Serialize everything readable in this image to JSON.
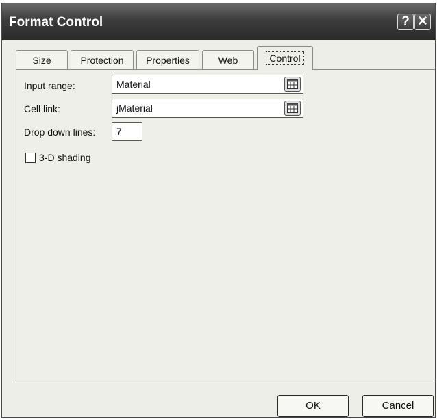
{
  "window": {
    "title": "Format Control",
    "help_label": "?",
    "close_label": "✕"
  },
  "tabs": [
    {
      "label": "Size",
      "active": false
    },
    {
      "label": "Protection",
      "active": false
    },
    {
      "label": "Properties",
      "active": false
    },
    {
      "label": "Web",
      "active": false
    },
    {
      "label": "Control",
      "active": true
    }
  ],
  "control": {
    "input_range": {
      "label": "Input range:",
      "value": "Material",
      "icon": "range-picker-icon"
    },
    "cell_link": {
      "label": "Cell link:",
      "value": "jMaterial",
      "icon": "range-picker-icon"
    },
    "drop_down_lines": {
      "label": "Drop down lines:",
      "value": "7"
    },
    "shading": {
      "label": "3-D shading",
      "checked": false
    }
  },
  "buttons": {
    "ok": "OK",
    "cancel": "Cancel"
  }
}
